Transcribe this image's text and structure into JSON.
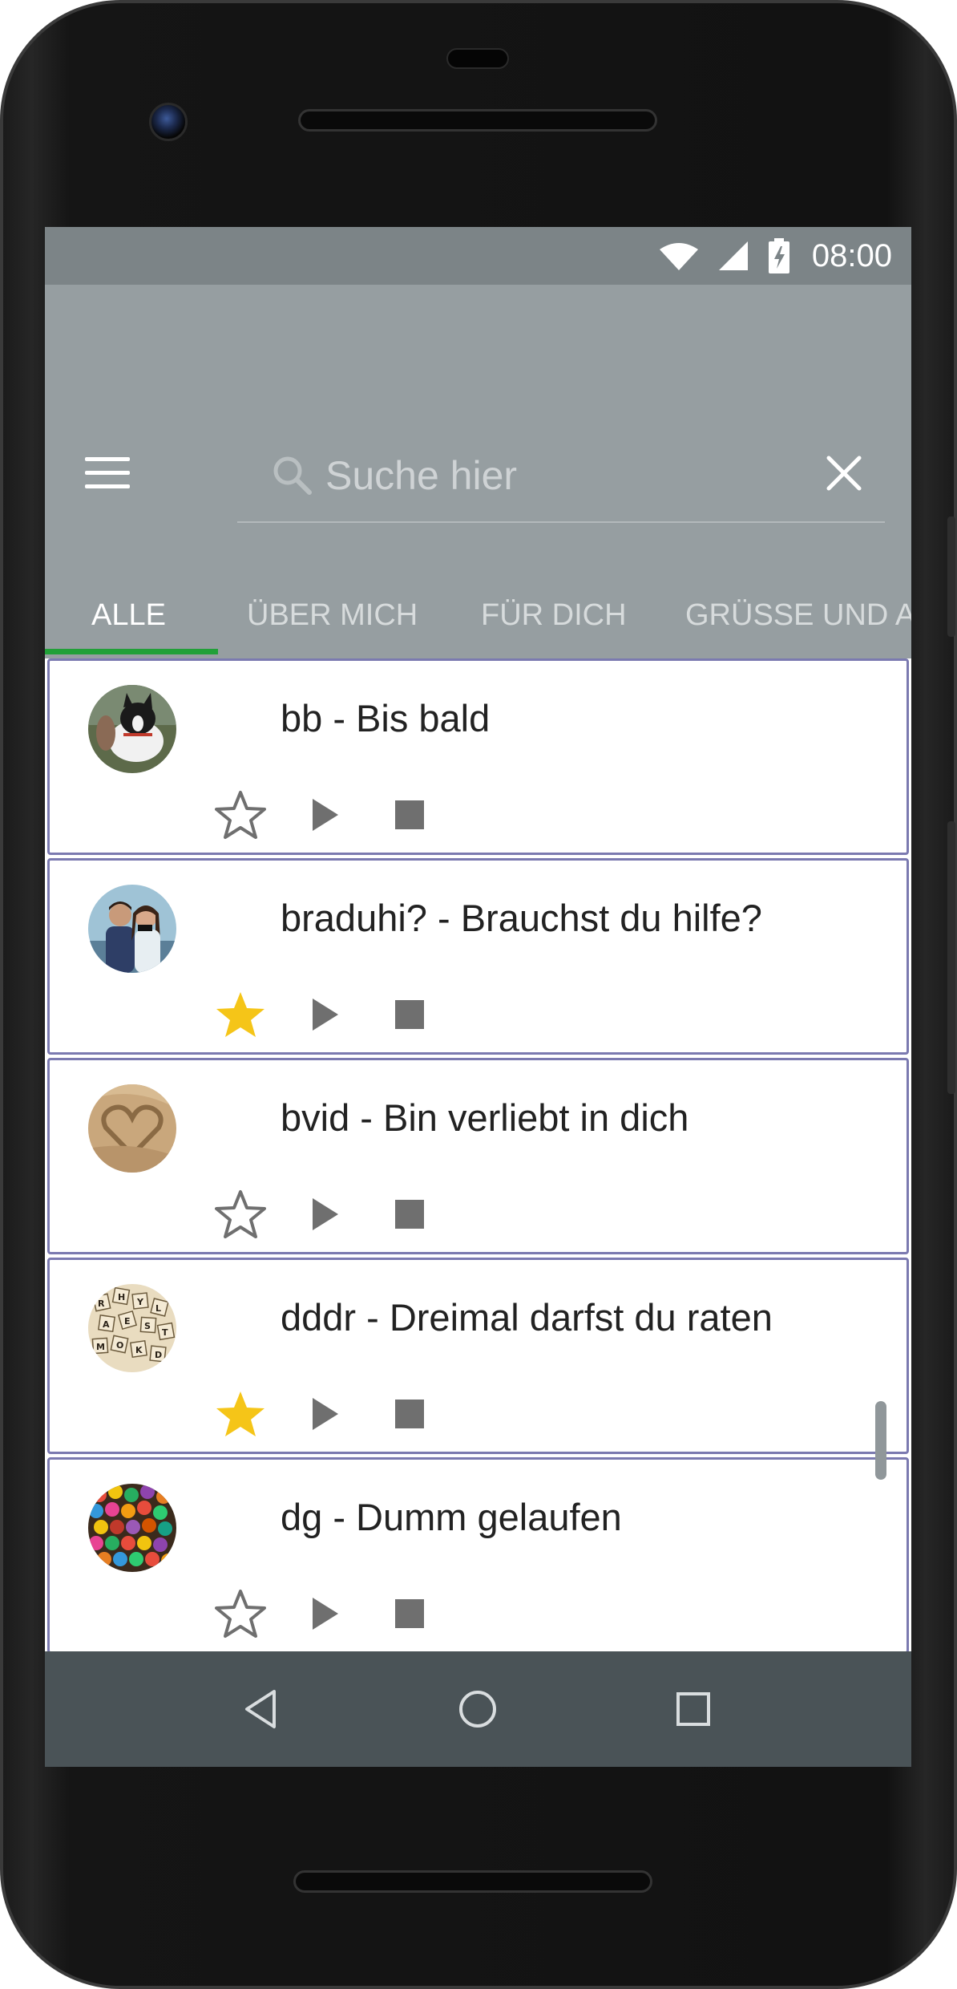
{
  "status_bar": {
    "time": "08:00",
    "icons": [
      "wifi-icon",
      "cell-signal-icon",
      "battery-charging-icon"
    ]
  },
  "header": {
    "menu_icon": "hamburger-menu-icon",
    "search": {
      "placeholder": "Suche hier",
      "value": ""
    },
    "close_icon": "close-icon"
  },
  "tabs": [
    {
      "label": "ALLE",
      "active": true
    },
    {
      "label": "ÜBER MICH",
      "active": false
    },
    {
      "label": "FÜR DICH",
      "active": false
    },
    {
      "label": "GRÜSSE UND A",
      "active": false
    }
  ],
  "colors": {
    "status_bar": "#7c8487",
    "header": "#969ea1",
    "tab_indicator": "#21a038",
    "card_border": "#7b7ab0",
    "star_filled": "#f5c518",
    "icon_gray": "#707070",
    "nav_bar": "#4a5357"
  },
  "items": [
    {
      "title": "bb - Bis bald",
      "favorite": false,
      "avatar": "dog-photo"
    },
    {
      "title": "braduhi? - Brauchst du hilfe?",
      "favorite": true,
      "avatar": "couple-photo"
    },
    {
      "title": "bvid - Bin verliebt in dich",
      "favorite": false,
      "avatar": "sand-heart-photo"
    },
    {
      "title": "dddr - Dreimal darfst du raten",
      "favorite": true,
      "avatar": "letter-tiles-photo"
    },
    {
      "title": "dg - Dumm gelaufen",
      "favorite": false,
      "avatar": "candy-photo"
    }
  ],
  "nav": [
    "back-icon",
    "home-icon",
    "recents-icon"
  ]
}
